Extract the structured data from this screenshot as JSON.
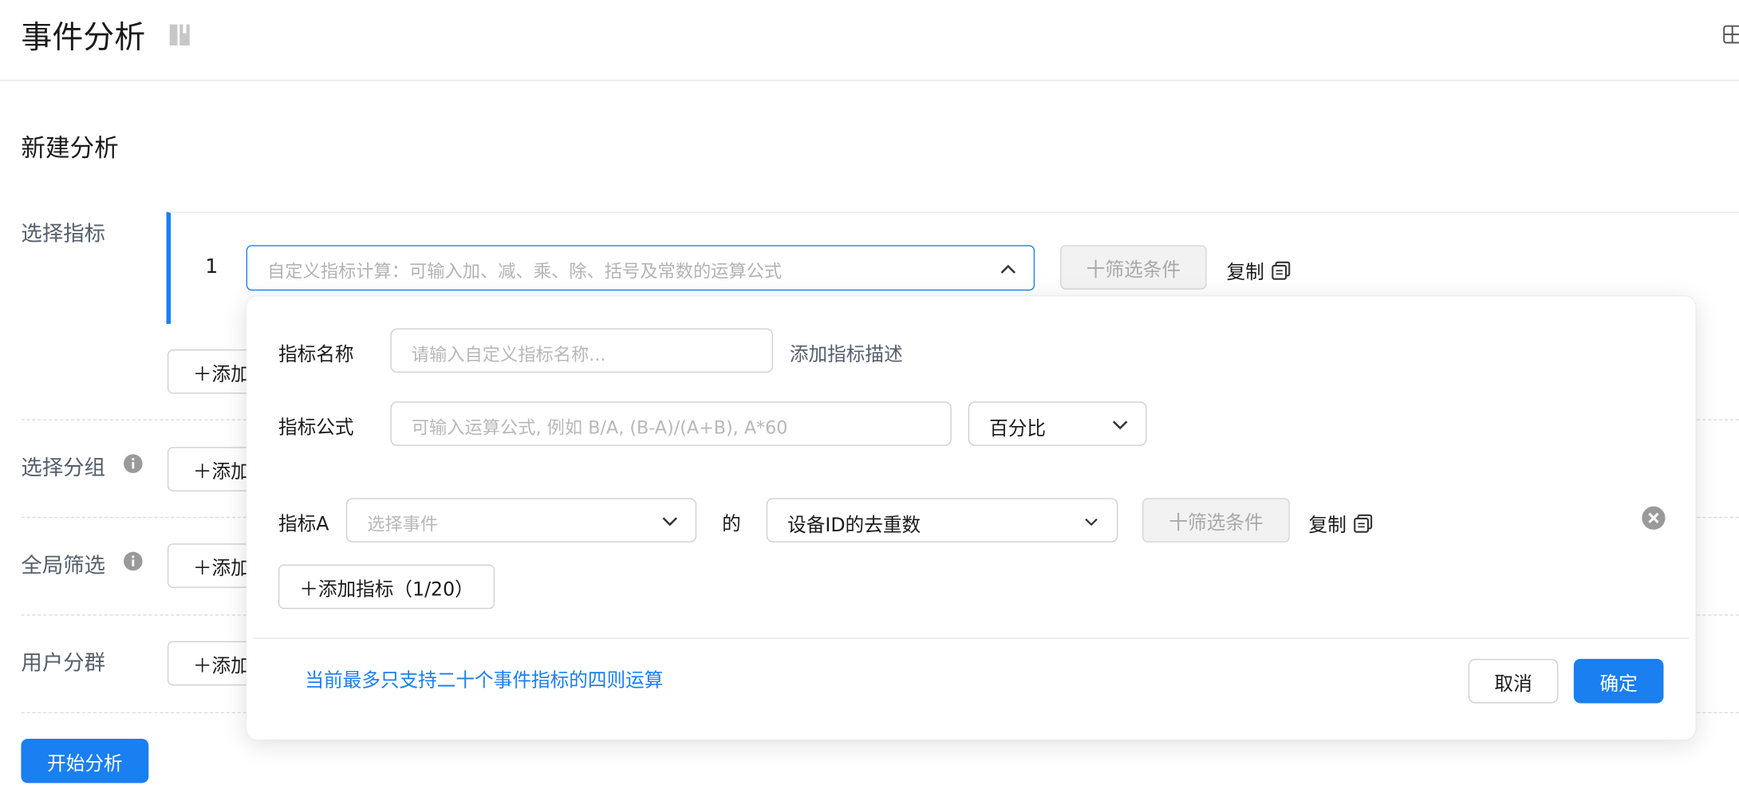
{
  "header": {
    "title": "事件分析",
    "book_icon": "book-icon",
    "grid_icon": "grid-add-icon"
  },
  "section": {
    "title": "新建分析"
  },
  "rows": {
    "metrics_label": "选择指标",
    "group_label": "选择分组",
    "filter_label": "全局筛选",
    "segment_label": "用户分群",
    "info_icon": "info-icon"
  },
  "metric_item": {
    "index": "1",
    "formula_placeholder": "自定义指标计算：可输入加、减、乘、除、括号及常数的运算公式",
    "filter_button": "十筛选条件",
    "copy_label": "复制"
  },
  "add_buttons": {
    "metrics": "＋添加",
    "group": "＋添加",
    "filter": "＋添加",
    "segment": "＋添加"
  },
  "start_button": "开始分析",
  "popup": {
    "name_label": "指标名称",
    "name_placeholder": "请输入自定义指标名称...",
    "add_description": "添加指标描述",
    "formula_label": "指标公式",
    "formula_placeholder": "可输入运算公式, 例如 B/A, (B-A)/(A+B), A*60",
    "format_select": "百分比",
    "metric_a_label": "指标A",
    "event_placeholder": "选择事件",
    "of_text": "的",
    "measure_select": "设备ID的去重数",
    "filter_button": "十筛选条件",
    "copy_label": "复制",
    "add_metric_button": "＋添加指标（1/20）",
    "hint": "当前最多只支持二十个事件指标的四则运算",
    "cancel": "取消",
    "confirm": "确定"
  },
  "colors": {
    "accent": "#1a7ff0",
    "muted_text": "#555e6b",
    "placeholder": "#b3b3b3"
  }
}
